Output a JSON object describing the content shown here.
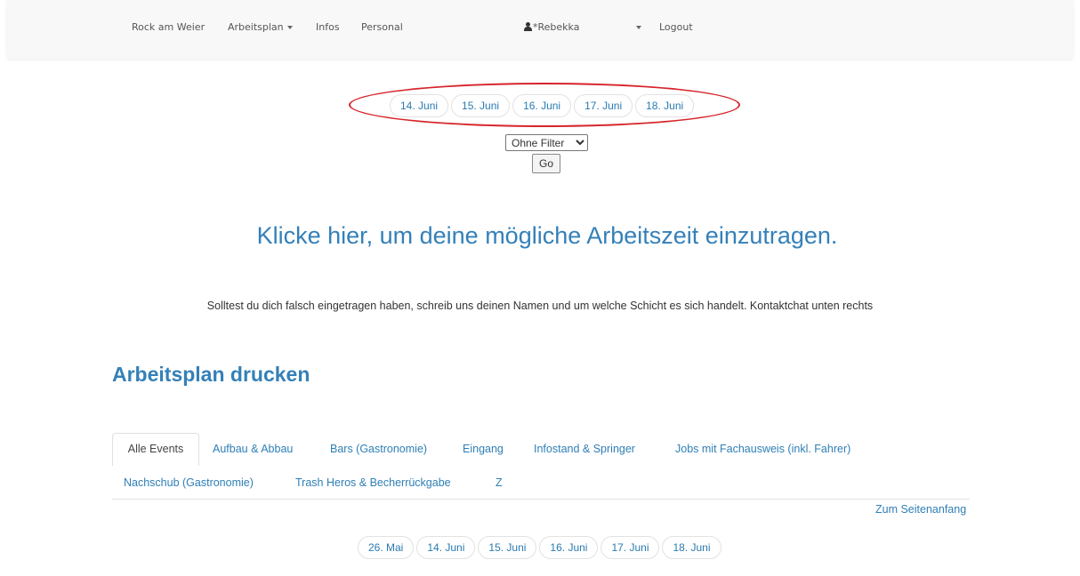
{
  "navbar": {
    "brand": "Rock am Weier",
    "arbeitsplan": "Arbeitsplan",
    "infos": "Infos",
    "personal": "Personal",
    "user": "*Rebekka",
    "logout": "Logout"
  },
  "top_dates": [
    "14. Juni",
    "15. Juni",
    "16. Juni",
    "17. Juni",
    "18. Juni"
  ],
  "filter": {
    "selected": "Ohne Filter",
    "go_label": "Go"
  },
  "cta_heading": "Klicke hier, um deine mögliche Arbeitszeit einzutragen.",
  "info_text": "Solltest du dich falsch eingetragen haben, schreib uns deinen Namen und um welche Schicht es sich handelt. Kontaktchat unten rechts",
  "print_heading": "Arbeitsplan drucken",
  "tabs": [
    "Alle Events",
    "Aufbau & Abbau",
    "Bars (Gastronomie)",
    "Eingang",
    "Infostand & Springer",
    "Jobs mit Fachausweis (inkl. Fahrer)",
    "Nachschub (Gastronomie)",
    "Trash Heros & Becherrückgabe",
    "Z"
  ],
  "back_to_top": "Zum Seitenanfang",
  "bottom_dates": [
    "26. Mai",
    "14. Juni",
    "15. Juni",
    "16. Juni",
    "17. Juni",
    "18. Juni"
  ],
  "colors": {
    "accent": "#3480b8",
    "highlight": "#d6252b"
  }
}
